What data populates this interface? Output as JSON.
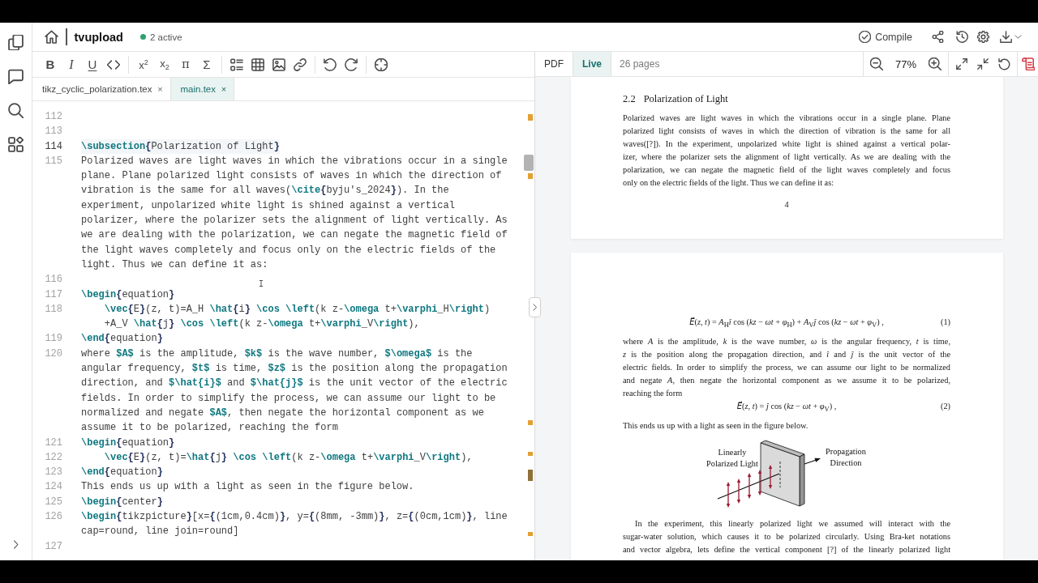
{
  "topbar": {
    "project": "tvupload",
    "presence": "2 active",
    "compile": "Compile"
  },
  "editor": {
    "toolbar": [
      [
        {
          "kind": "bold",
          "label": "B"
        },
        {
          "kind": "italic",
          "label": "I"
        },
        {
          "kind": "underline",
          "label": "U"
        },
        {
          "kind": "code"
        }
      ],
      [
        {
          "kind": "superscript",
          "label": "x$^{2}$"
        },
        {
          "kind": "subscript",
          "label": "x$_{2}$"
        },
        {
          "kind": "greek",
          "label": "π"
        },
        {
          "kind": "math",
          "label": "Σ"
        }
      ],
      [
        {
          "kind": "list"
        },
        {
          "kind": "table"
        },
        {
          "kind": "figure"
        },
        {
          "kind": "link"
        }
      ],
      [
        {
          "kind": "undo"
        },
        {
          "kind": "redo"
        }
      ],
      [
        {
          "kind": "target"
        }
      ]
    ],
    "tabs": [
      {
        "label": "tikz_cyclic_polarization.tex",
        "close": "×",
        "selected": false
      },
      {
        "label": "main.tex",
        "close": "×",
        "selected": true
      }
    ],
    "lines": [
      {
        "number": "112",
        "active": false
      },
      {
        "number": "113",
        "active": false
      },
      {
        "number": "114",
        "text": "\\subsection{Polarization of Light}",
        "active": true
      },
      {
        "number": "115",
        "text": "Polarized waves are light waves in which the vibrations occur in a single plane. Plane polarized light consists of waves in which the direction of vibration is the same for all waves(\\cite{byju's_2024}). In the experiment, unpolarized white light is shined against a vertical polarizer, where the polarizer sets the alignment of light vertically. As we are dealing with the polarization, we can negate the magnetic field of the light waves completely and focus only on the electric fields of the light. Thus we can define it as:",
        "active": false
      },
      {
        "number": "116",
        "active": false
      },
      {
        "number": "117",
        "text": "\\begin{equation}",
        "active": false
      },
      {
        "number": "118",
        "text": "    \\vec{E}(z, t)=A_H \\hat{i} \\cos \\left(k z-\\omega t+\\varphi_H\\right) +A_V \\hat{j} \\cos \\left(k z-\\omega t+\\varphi_V\\right),",
        "active": false
      },
      {
        "number": "119",
        "text": "\\end{equation}",
        "active": false
      },
      {
        "number": "120",
        "text": "where $A$ is the amplitude, $k$ is the wave number, $\\omega$ is the angular frequency, $t$ is time, $z$ is the position along the propagation direction, and $\\hat{i}$ and $\\hat{j}$ is the unit vector of the electric fields. In order to simplify the process, we can assume our light to be normalized and negate $A$, then negate the horizontal component as we assume it to be polarized, reaching the form",
        "active": false
      },
      {
        "number": "121",
        "text": "\\begin{equation}",
        "active": false
      },
      {
        "number": "122",
        "text": "    \\vec{E}(z, t)=\\hat{j} \\cos \\left(k z-\\omega t+\\varphi_V\\right),",
        "active": false
      },
      {
        "number": "123",
        "text": "\\end{equation}",
        "active": false
      },
      {
        "number": "124",
        "text": "This ends us up with a light as seen in the figure below.",
        "active": false
      },
      {
        "number": "125",
        "text": "\\begin{center}",
        "active": false
      },
      {
        "number": "126",
        "text": "\\begin{tikzpicture}[x={(1cm,0.4cm)}, y={(8mm, -3mm)}, z={(0cm,1cm)}, line cap=round, line join=round]",
        "active": false
      },
      {
        "number": "127",
        "active": false
      }
    ]
  },
  "pdf": {
    "tabs": [
      {
        "label": "PDF",
        "selected": false
      },
      {
        "label": "Live",
        "selected": true
      }
    ],
    "page_count": "26 pages",
    "zoom": "77%",
    "pages": [
      {
        "blocks": [
          {
            "kind": "heading",
            "number": "2.2",
            "title": "Polarization of Light"
          },
          {
            "kind": "paragraph",
            "indent": false,
            "continues": false,
            "lines": [
              "Polarized waves are light waves in which the vibrations occur in a single plane. Plane",
              "polarized light consists of waves in which the direction of vibration is the same for all",
              "waves([?]). In the experiment, unpolarized white light is shined against a vertical polar-",
              "izer, where the polarizer sets the alignment of light vertically. As we are dealing with the",
              "polarization, we can negate the magnetic field of the light waves completely and focus",
              "only on the electric fields of the light. Thus we can define it as:"
            ]
          },
          {
            "kind": "page_number",
            "text": "4"
          }
        ]
      },
      {
        "blocks": [
          {
            "kind": "equation",
            "expression": "*E⃗*(*z*, *t*) = *A*$_{H}$*î* cos (*kz* − *ωt* + *φ*$_{H}$) + *A*$_{V}$*ĵ* cos (*kz* − *ωt* + *φ*$_{V}$) ,",
            "number": "(1)"
          },
          {
            "kind": "paragraph",
            "indent": false,
            "continues": false,
            "lines": [
              "where *A* is the amplitude, *k* is the wave number, *ω* is the angular frequency, *t* is time,",
              "*z* is the position along the propagation direction, and *î* and *ĵ* is the unit vector of the",
              "electric fields. In order to simplify the process, we can assume our light to be normalized",
              "and negate *A*, then negate the horizontal component as we assume it to be polarized,",
              "reaching the form"
            ]
          },
          {
            "kind": "equation",
            "expression": "*E⃗*(*z*, *t*) = *ĵ* cos (*kz* − *ωt* + *φ*$_{V}$) ,",
            "number": "(2)"
          },
          {
            "kind": "paragraph",
            "indent": false,
            "continues": false,
            "lines": [
              "This ends us up with a light as seen in the figure below."
            ]
          },
          {
            "kind": "figure",
            "labels": [
              {
                "lines": [
                  "Linearly",
                  "Polarized Light"
                ]
              },
              {
                "lines": [
                  "Propagation",
                  "Direction"
                ]
              }
            ]
          },
          {
            "kind": "paragraph",
            "indent": true,
            "continues": true,
            "lines": [
              "In the experiment, this linearly polarized light we assumed will interact with the",
              "sugar-water solution, which causes it to be polarized circularly. Using Bra-ket notations",
              "and vector algebra, lets define the vertical component [?] of the linearly polarized light"
            ]
          }
        ]
      }
    ]
  }
}
